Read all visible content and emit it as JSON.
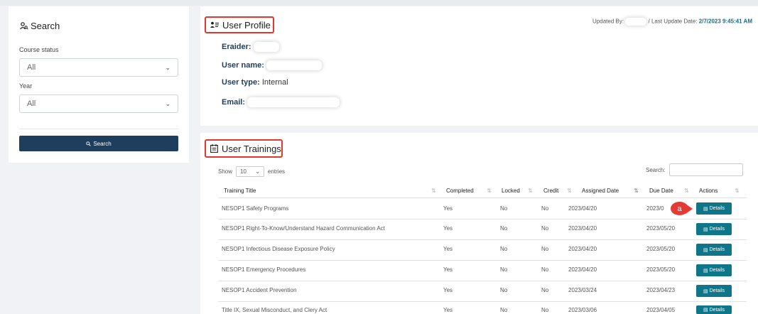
{
  "search_panel": {
    "title": "Search",
    "course_status_label": "Course status",
    "course_status_value": "All",
    "year_label": "Year",
    "year_value": "All",
    "search_button": "Search"
  },
  "profile": {
    "title": "User Profile",
    "updated_by_label": "Updated By:",
    "last_update_label": "/ Last Update Date:",
    "last_update_value": "2/7/2023 9:45:41 AM",
    "eraider_label": "Eraider:",
    "user_name_label": "User name:",
    "user_type_label": "User type:",
    "user_type_value": "Internal",
    "email_label": "Email:"
  },
  "trainings": {
    "title": "User Trainings",
    "show_label": "Show",
    "entries_value": "10",
    "entries_label": "entries",
    "search_label": "Search:",
    "columns": [
      "Training Title",
      "Completed",
      "Locked",
      "Credit",
      "Assigned Date",
      "Due Date",
      "Actions"
    ],
    "details_label": "Details",
    "marker_label": "a",
    "rows": [
      {
        "title": "NESOP1 Safety Programs",
        "completed": "Yes",
        "locked": "No",
        "credit": "No",
        "assigned": "2023/04/20",
        "due": "2023/0"
      },
      {
        "title": "NESOP1 Right-To-Know/Understand Hazard Communication Act",
        "completed": "Yes",
        "locked": "No",
        "credit": "No",
        "assigned": "2023/04/20",
        "due": "2023/05/20"
      },
      {
        "title": "NESOP1 Infectious Disease Exposure Policy",
        "completed": "Yes",
        "locked": "No",
        "credit": "No",
        "assigned": "2023/04/20",
        "due": "2023/05/20"
      },
      {
        "title": "NESOP1 Emergency Procedures",
        "completed": "Yes",
        "locked": "No",
        "credit": "No",
        "assigned": "2023/04/20",
        "due": "2023/05/20"
      },
      {
        "title": "NESOP1 Accident Prevention",
        "completed": "Yes",
        "locked": "No",
        "credit": "No",
        "assigned": "2023/03/24",
        "due": "2023/04/23"
      },
      {
        "title": "Title IX, Sexual Misconduct, and Clery Act",
        "completed": "Yes",
        "locked": "No",
        "credit": "No",
        "assigned": "2023/03/06",
        "due": "2023/04/05"
      }
    ]
  },
  "colors": {
    "primary_dark": "#1f3d5c",
    "teal": "#0f7588",
    "highlight_red": "#e2372e"
  }
}
